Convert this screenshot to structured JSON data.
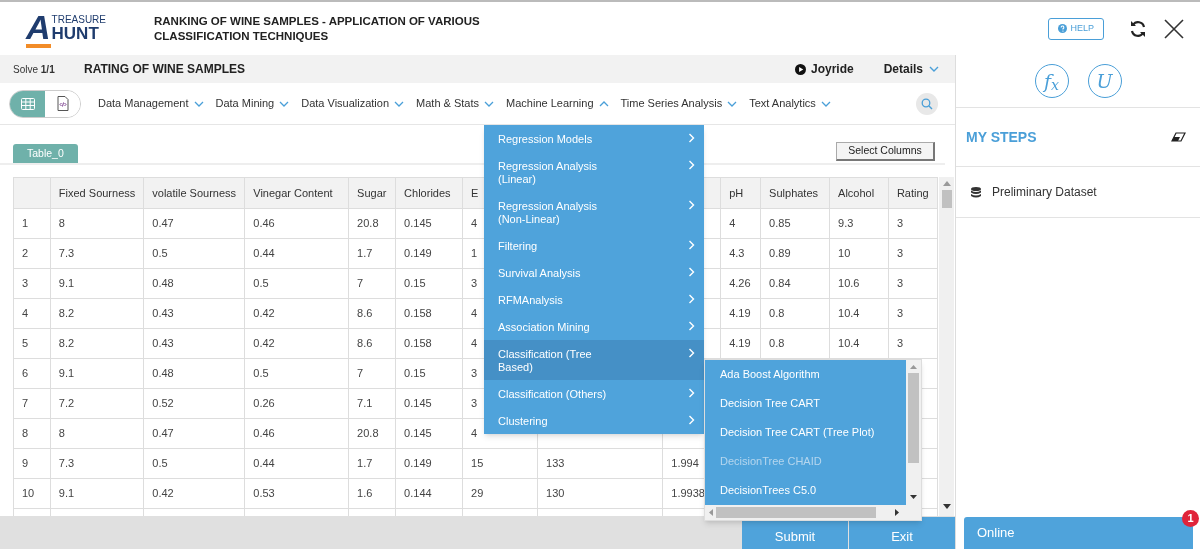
{
  "header": {
    "logo": {
      "mark": "A",
      "top": "TREASURE",
      "bottom": "HUNT"
    },
    "title": "RANKING OF WINE SAMPLES - APPLICATION OF VARIOUS CLASSIFICATION TECHNIQUES",
    "help": "HELP"
  },
  "task_bar": {
    "solve_label": "Solve",
    "solve_count": "1/1",
    "title": "RATING OF WINE SAMPLES",
    "joyride": "Joyride",
    "details": "Details"
  },
  "view_toggle": [
    {
      "kind": "grid",
      "selected": true
    },
    {
      "kind": "code",
      "selected": false
    }
  ],
  "nav": [
    {
      "label": "Data Management",
      "expanded": false
    },
    {
      "label": "Data Mining",
      "expanded": false
    },
    {
      "label": "Data Visualization",
      "expanded": false
    },
    {
      "label": "Math & Stats",
      "expanded": false
    },
    {
      "label": "Machine Learning",
      "expanded": true
    },
    {
      "label": "Time Series Analysis",
      "expanded": false
    },
    {
      "label": "Text Analytics",
      "expanded": false
    }
  ],
  "table_tabs": [
    {
      "label": "Table_0",
      "selected": true
    }
  ],
  "select_columns": "Select Columns",
  "table": {
    "columns": [
      null,
      "Fixed Sourness",
      "volatile Sourness",
      "Vinegar Content",
      "Sugar",
      "Chlorides",
      "E",
      null,
      null,
      "pH",
      "Sulphates",
      "Alcohol",
      "Rating"
    ],
    "rows": [
      [
        "1",
        "8",
        "0.47",
        "0.46",
        "20.8",
        "0.145",
        "4",
        null,
        null,
        "4",
        "0.85",
        "9.3",
        "3"
      ],
      [
        "2",
        "7.3",
        "0.5",
        "0.44",
        "1.7",
        "0.149",
        "1",
        null,
        null,
        "4.3",
        "0.89",
        "10",
        "3"
      ],
      [
        "3",
        "9.1",
        "0.48",
        "0.5",
        "7",
        "0.15",
        "3",
        null,
        null,
        "4.26",
        "0.84",
        "10.6",
        "3"
      ],
      [
        "4",
        "8.2",
        "0.43",
        "0.42",
        "8.6",
        "0.158",
        "4",
        null,
        null,
        "4.19",
        "0.8",
        "10.4",
        "3"
      ],
      [
        "5",
        "8.2",
        "0.43",
        "0.42",
        "8.6",
        "0.158",
        "4",
        null,
        null,
        "4.19",
        "0.8",
        "10.4",
        "3"
      ],
      [
        "6",
        "9.1",
        "0.48",
        "0.5",
        "7",
        "0.15",
        "3",
        null,
        null,
        null,
        null,
        null,
        null
      ],
      [
        "7",
        "7.2",
        "0.52",
        "0.26",
        "7.1",
        "0.145",
        "3",
        null,
        null,
        null,
        null,
        null,
        null
      ],
      [
        "8",
        "8",
        "0.47",
        "0.46",
        "20.8",
        "0.145",
        "4",
        null,
        null,
        null,
        null,
        null,
        null
      ],
      [
        "9",
        "7.3",
        "0.5",
        "0.44",
        "1.7",
        "0.149",
        "15",
        "133",
        "1.994",
        null,
        null,
        null,
        null
      ],
      [
        "10",
        "9.1",
        "0.42",
        "0.53",
        "1.6",
        "0.144",
        "29",
        "130",
        "1.9938",
        null,
        null,
        null,
        null
      ]
    ]
  },
  "menu": [
    {
      "label": "Regression Models",
      "selected": false
    },
    {
      "label": "Regression Analysis (Linear)",
      "selected": false
    },
    {
      "label": "Regression Analysis (Non-Linear)",
      "selected": false
    },
    {
      "label": "Filtering",
      "selected": false
    },
    {
      "label": "Survival Analysis",
      "selected": false
    },
    {
      "label": "RFMAnalysis",
      "selected": false
    },
    {
      "label": "Association Mining",
      "selected": false
    },
    {
      "label": "Classification (Tree Based)",
      "selected": true
    },
    {
      "label": "Classification (Others)",
      "selected": false
    },
    {
      "label": "Clustering",
      "selected": false
    }
  ],
  "submenu": [
    {
      "label": "Ada Boost Algorithm",
      "disabled": false
    },
    {
      "label": "Decision Tree CART",
      "disabled": false
    },
    {
      "label": "Decision Tree CART (Tree Plot)",
      "disabled": false
    },
    {
      "label": "DecisionTree CHAID",
      "disabled": true
    },
    {
      "label": "DecisionTrees C5.0",
      "disabled": false
    }
  ],
  "footer_buttons": [
    "Submit",
    "Exit"
  ],
  "side_panel": {
    "tools": [
      "f$_{x}$",
      "U"
    ],
    "title": "MY STEPS",
    "steps": [
      "Preliminary Dataset"
    ],
    "online": "Online",
    "badge": "1"
  }
}
